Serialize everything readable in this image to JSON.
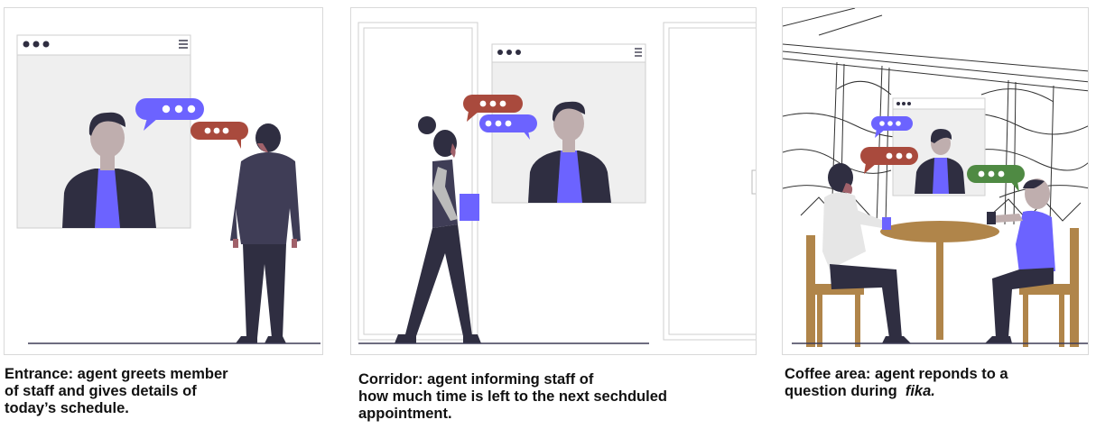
{
  "panels": [
    {
      "caption_lines": [
        "Entrance: agent greets member",
        "of staff and gives details of",
        "today’s schedule."
      ]
    },
    {
      "caption_lines": [
        "Corridor: agent informing staff of",
        "how much time is left to the next sechduled",
        "appointment."
      ]
    },
    {
      "caption_lines": [
        "Coffee area: agent reponds to a",
        "question during"
      ],
      "caption_emphasis": "fika."
    }
  ],
  "colors": {
    "purple": "#6c63ff",
    "red": "#a94a3d",
    "green": "#4f8a43",
    "dark": "#2f2e41",
    "skin": "#a0616a",
    "skin_light": "#bfaeae",
    "wood": "#b0854a",
    "screen": "#efefef"
  }
}
